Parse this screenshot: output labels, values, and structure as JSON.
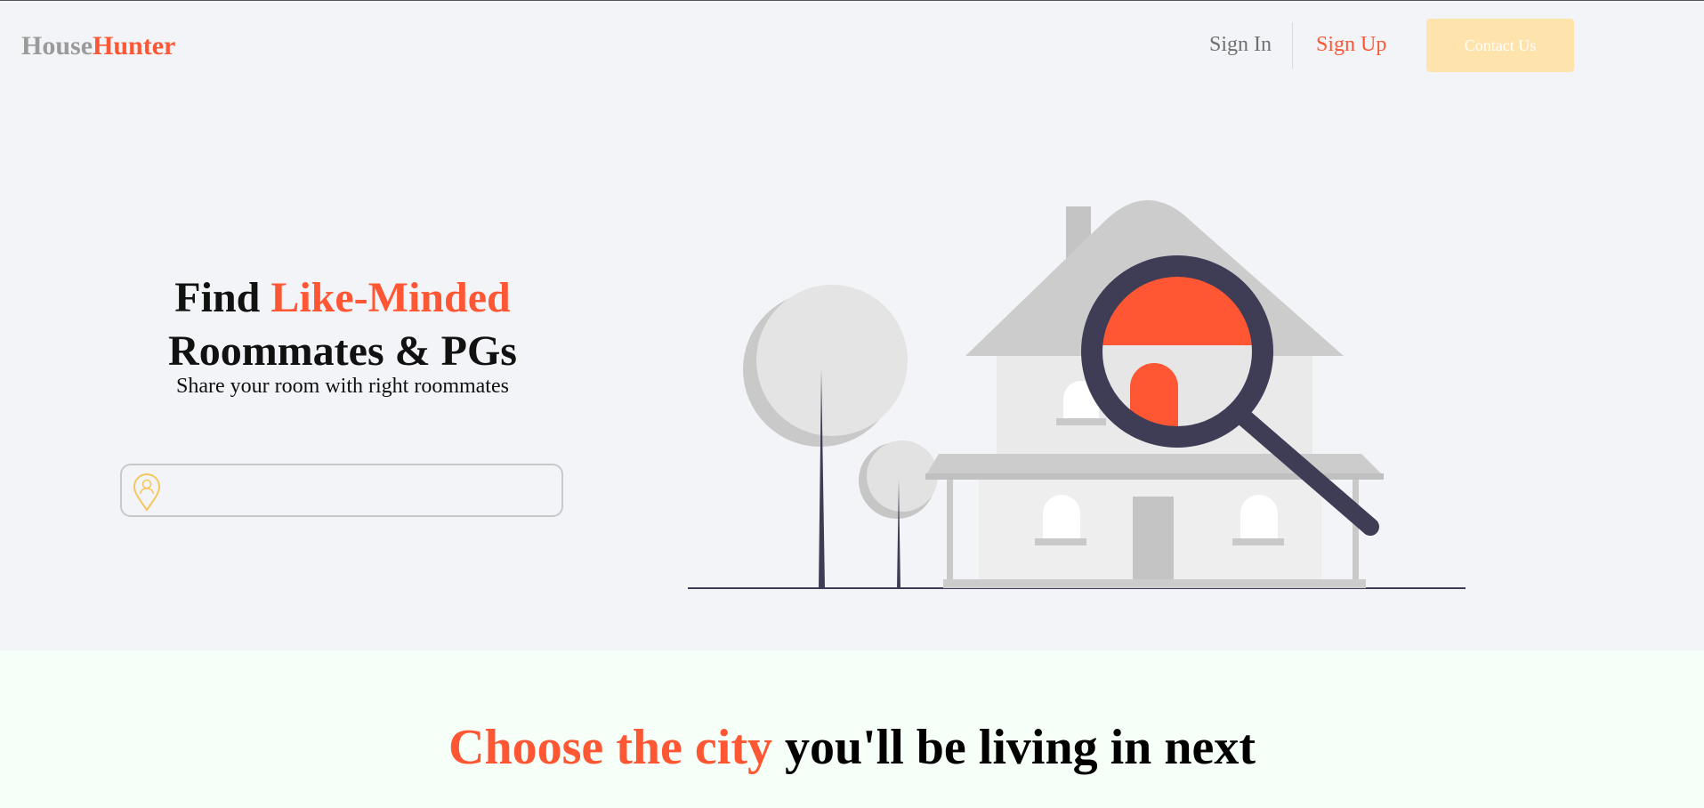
{
  "brand": {
    "part1": "House",
    "part2": "Hunter"
  },
  "nav": {
    "sign_in": "Sign In",
    "sign_up": "Sign Up",
    "contact": "Contact Us"
  },
  "hero": {
    "title_pre": "Find ",
    "title_accent": "Like-Minded",
    "title_line2": "Roommates & PGs",
    "subtitle": "Share your room with right roommates",
    "search_value": "",
    "search_placeholder": ""
  },
  "section": {
    "heading_accent": "Choose the city",
    "heading_rest": " you'll be living in next"
  },
  "colors": {
    "accent": "#ff5733",
    "contact_bg": "#ffe3ad",
    "page_bg": "#f3f4f8",
    "section_bg": "#f6fff8",
    "magnifier": "#3f3d56"
  },
  "icons": {
    "location": "location-pin-user-icon"
  }
}
